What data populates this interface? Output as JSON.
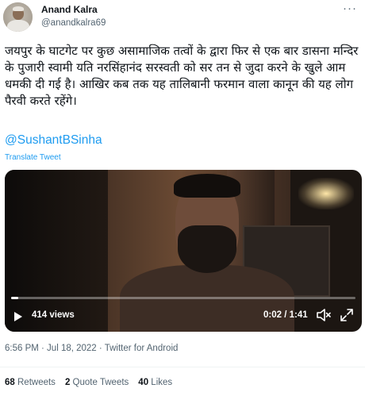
{
  "author": {
    "name": "Anand Kalra",
    "handle": "@anandkalra69"
  },
  "tweet": {
    "text": "जयपुर के घाटगेट पर कुछ असामाजिक तत्वों के द्वारा फिर से एक बार डासना मन्दिर के पुजारी स्वामी यति नरसिंहानंद सरस्वती को सर तन से जुदा करने के खुले आम धमकी दी गई है। आखिर कब तक यह तालिबानी फरमान वाला कानून की यह लोग पैरवी करते रहेंगे।",
    "mention": "@SushantBSinha",
    "translate": "Translate Tweet",
    "more": "···"
  },
  "video": {
    "views": "414 views",
    "time": "0:02 / 1:41",
    "progress": 0.02
  },
  "meta": "6:56 PM · Jul 18, 2022 · Twitter for Android",
  "stats": {
    "retweets_count": "68",
    "retweets_label": "Retweets",
    "quotes_count": "2",
    "quotes_label": "Quote Tweets",
    "likes_count": "40",
    "likes_label": "Likes"
  },
  "colors": {
    "accent": "#1d9bf0",
    "secondary_text": "#536471"
  }
}
